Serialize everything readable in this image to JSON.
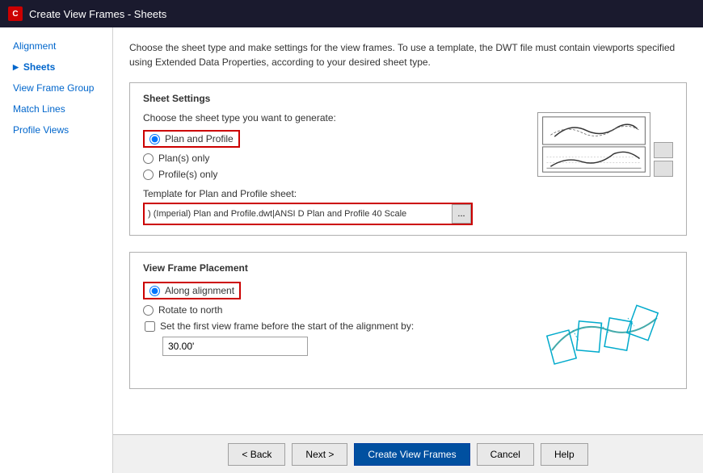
{
  "titleBar": {
    "icon": "C",
    "title": "Create View Frames - Sheets"
  },
  "sidebar": {
    "items": [
      {
        "id": "alignment",
        "label": "Alignment",
        "active": false
      },
      {
        "id": "sheets",
        "label": "Sheets",
        "active": true
      },
      {
        "id": "view-frame-group",
        "label": "View Frame Group",
        "active": false
      },
      {
        "id": "match-lines",
        "label": "Match Lines",
        "active": false
      },
      {
        "id": "profile-views",
        "label": "Profile Views",
        "active": false
      }
    ]
  },
  "description": "Choose the sheet type and make settings for the view frames. To use a template, the DWT file must contain viewports specified using Extended Data Properties, according to your desired sheet type.",
  "sheetSettings": {
    "sectionTitle": "Sheet Settings",
    "chooseLabel": "Choose the sheet type you want to generate:",
    "options": [
      {
        "id": "plan-profile",
        "label": "Plan and Profile",
        "selected": true
      },
      {
        "id": "plans-only",
        "label": "Plan(s) only",
        "selected": false
      },
      {
        "id": "profiles-only",
        "label": "Profile(s) only",
        "selected": false
      }
    ],
    "templateLabel": "Template for Plan and Profile sheet:",
    "templateValue": ") (Imperial) Plan and Profile.dwt|ANSI D Plan and Profile 40 Scale",
    "templateBtnLabel": "..."
  },
  "viewFramePlacement": {
    "sectionTitle": "View Frame Placement",
    "options": [
      {
        "id": "along-alignment",
        "label": "Along alignment",
        "selected": true
      },
      {
        "id": "rotate-north",
        "label": "Rotate to north",
        "selected": false
      }
    ],
    "checkboxLabel": "Set the first view frame before the start of the alignment by:",
    "checkboxChecked": false,
    "offsetValue": "30.00'"
  },
  "buttons": {
    "back": "< Back",
    "next": "Next >",
    "createViewFrames": "Create View Frames",
    "cancel": "Cancel",
    "help": "Help"
  }
}
